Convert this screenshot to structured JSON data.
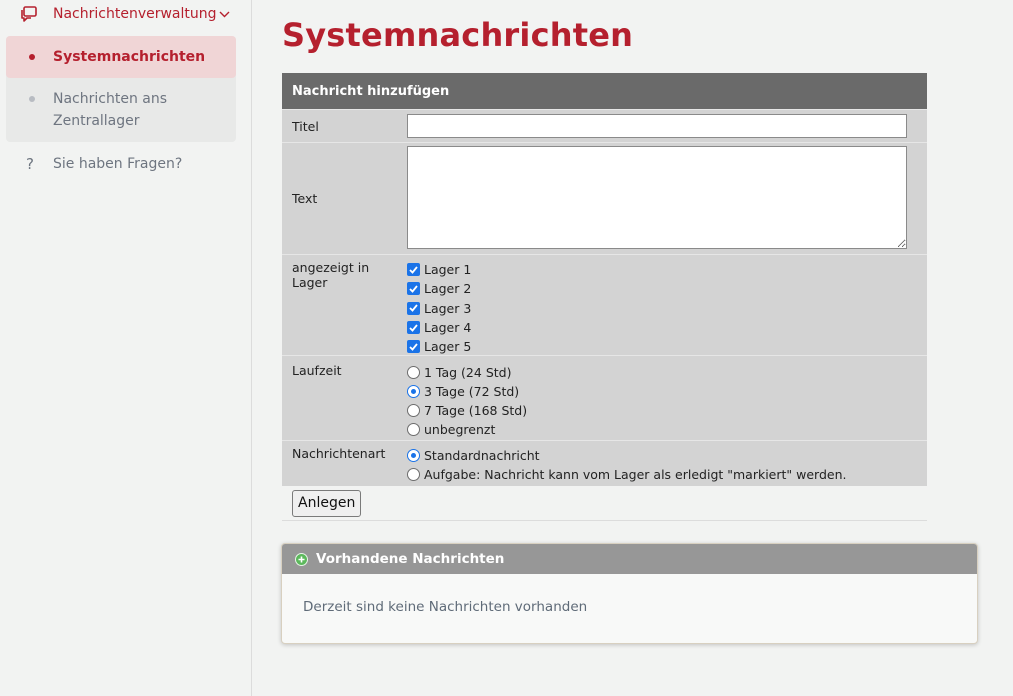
{
  "sidebar": {
    "parent_label": "Nachrichtenverwaltung",
    "items": [
      {
        "label": "Systemnachrichten",
        "active": true
      },
      {
        "label": "Nachrichten ans Zentrallager",
        "active": false
      }
    ],
    "help_label": "Sie haben Fragen?"
  },
  "page_title": "Systemnachrichten",
  "form": {
    "header": "Nachricht hinzufügen",
    "title_label": "Titel",
    "title_value": "",
    "text_label": "Text",
    "text_value": "",
    "lager_label": "angezeigt in Lager",
    "lager_options": [
      {
        "label": "Lager 1",
        "checked": true
      },
      {
        "label": "Lager 2",
        "checked": true
      },
      {
        "label": "Lager 3",
        "checked": true
      },
      {
        "label": "Lager 4",
        "checked": true
      },
      {
        "label": "Lager 5",
        "checked": true
      }
    ],
    "laufzeit_label": "Laufzeit",
    "laufzeit_options": [
      {
        "label": "1 Tag (24 Std)",
        "selected": false
      },
      {
        "label": "3 Tage (72 Std)",
        "selected": true
      },
      {
        "label": "7 Tage (168 Std)",
        "selected": false
      },
      {
        "label": "unbegrenzt",
        "selected": false
      }
    ],
    "art_label": "Nachrichtenart",
    "art_options": [
      {
        "label": "Standardnachricht",
        "selected": true
      },
      {
        "label": "Aufgabe: Nachricht kann vom Lager als erledigt \"markiert\" werden.",
        "selected": false
      }
    ],
    "submit_label": "Anlegen"
  },
  "existing": {
    "header": "Vorhandene Nachrichten",
    "empty_text": "Derzeit sind keine Nachrichten vorhanden"
  },
  "colors": {
    "accent": "#b5202e",
    "checkbox": "#1a73e8",
    "form_header": "#6a6a6a",
    "form_row": "#d3d3d3"
  }
}
